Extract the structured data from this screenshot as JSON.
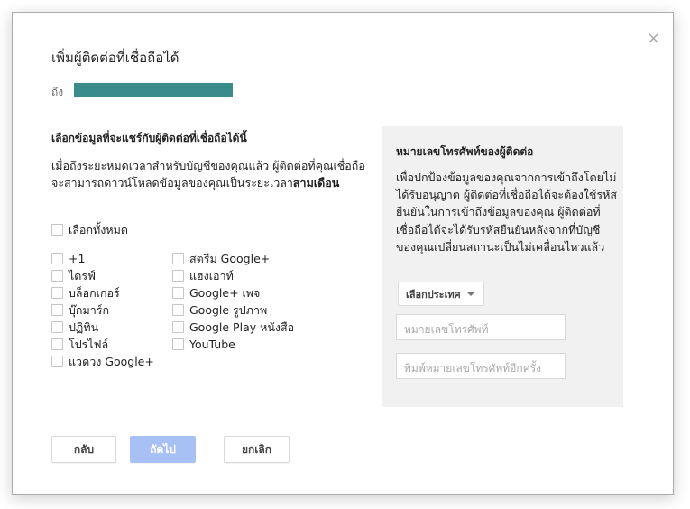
{
  "dialog": {
    "title": "เพิ่มผู้ติดต่อที่เชื่อถือได้",
    "close_label": "×",
    "to_label": "ถึง",
    "colors": {
      "recipient_bar": "#3a8c8a",
      "next_button": "#a7c1f6",
      "panel_bg": "#f1f1f1"
    }
  },
  "share": {
    "heading": "เลือกข้อมูลที่จะแชร์กับผู้ติดต่อที่เชื่อถือได้นี้",
    "description": "เมื่อถึงระยะหมดเวลาสำหรับบัญชีของคุณแล้ว ผู้ติดต่อที่คุณเชื่อถือจะสามารถดาวน์โหลดข้อมูลของคุณเป็นระยะเวลา",
    "description_bold": "สามเดือน",
    "select_all": "เลือกทั้งหมด",
    "items_col1": [
      "+1",
      "ไดรฟ์",
      "บล็อกเกอร์",
      "บุ๊กมาร์ก",
      "ปฏิทิน",
      "โปรไฟล์",
      "แวดวง Google+"
    ],
    "items_col2": [
      "สตรีม Google+",
      "แฮงเอาท์",
      "Google+ เพจ",
      "Google รูปภาพ",
      "Google Play หนังสือ",
      "YouTube"
    ]
  },
  "phone": {
    "heading": "หมายเลขโทรศัพท์ของผู้ติดต่อ",
    "description": "เพื่อปกป้องข้อมูลของคุณจากการเข้าถึงโดยไม่ได้รับอนุญาต ผู้ติดต่อที่เชื่อถือได้จะต้องใช้รหัสยืนยันในการเข้าถึงข้อมูลของคุณ ผู้ติดต่อที่เชื่อถือได้จะได้รับรหัสยืนยันหลังจากที่บัญชีของคุณเปลี่ยนสถานะเป็นไม่เคลื่อนไหวแล้ว",
    "country_select": "เลือกประเทศ",
    "phone_placeholder": "หมายเลขโทรศัพท์",
    "confirm_placeholder": "พิมพ์หมายเลขโทรศัพท์อีกครั้ง"
  },
  "buttons": {
    "back": "กลับ",
    "next": "ถัดไป",
    "cancel": "ยกเลิก"
  }
}
